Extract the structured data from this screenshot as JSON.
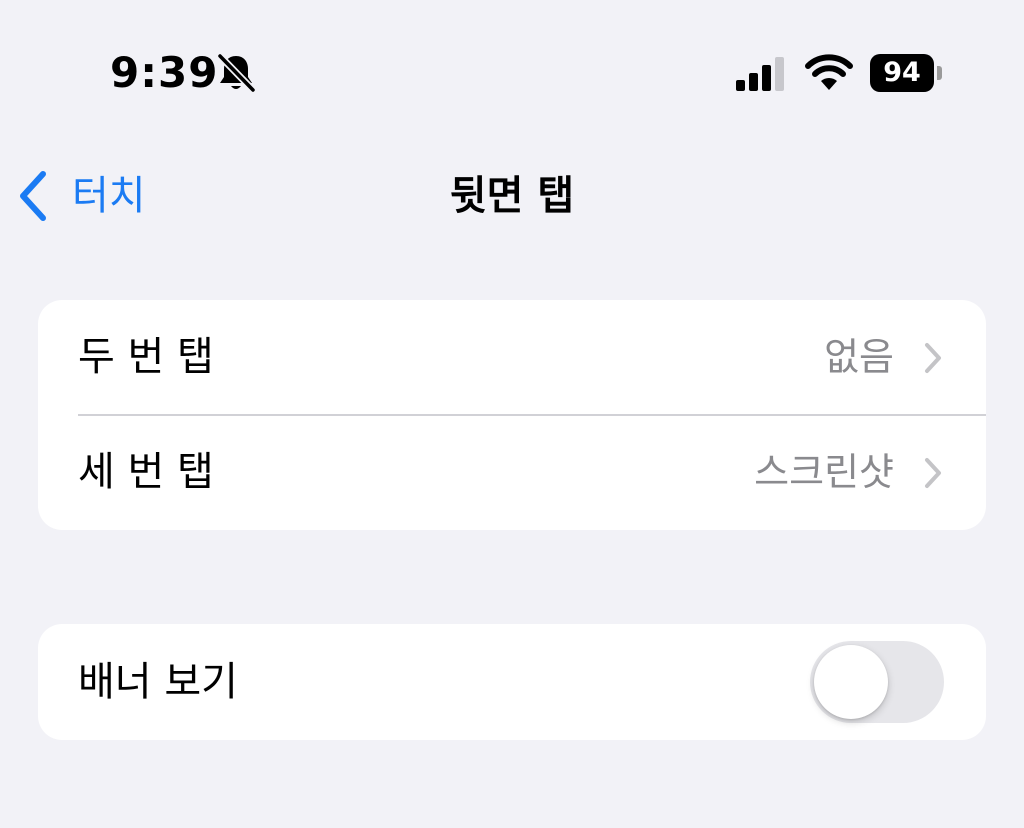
{
  "status_bar": {
    "time": "9:39",
    "battery": "94",
    "icons": [
      "bell-slash-icon",
      "cellular-signal-icon",
      "wifi-icon",
      "battery-icon"
    ]
  },
  "nav": {
    "back_label": "터치",
    "title": "뒷면 탭"
  },
  "tap_group": {
    "rows": [
      {
        "label": "두 번 탭",
        "value": "없음"
      },
      {
        "label": "세 번 탭",
        "value": "스크린샷"
      }
    ]
  },
  "banner_group": {
    "label": "배너 보기",
    "toggle_on": false
  },
  "colors": {
    "background": "#f2f2f7",
    "accent": "#1b7bf3",
    "secondary_text": "#8a8a8e",
    "toggle_off": "#e6e6ea"
  }
}
